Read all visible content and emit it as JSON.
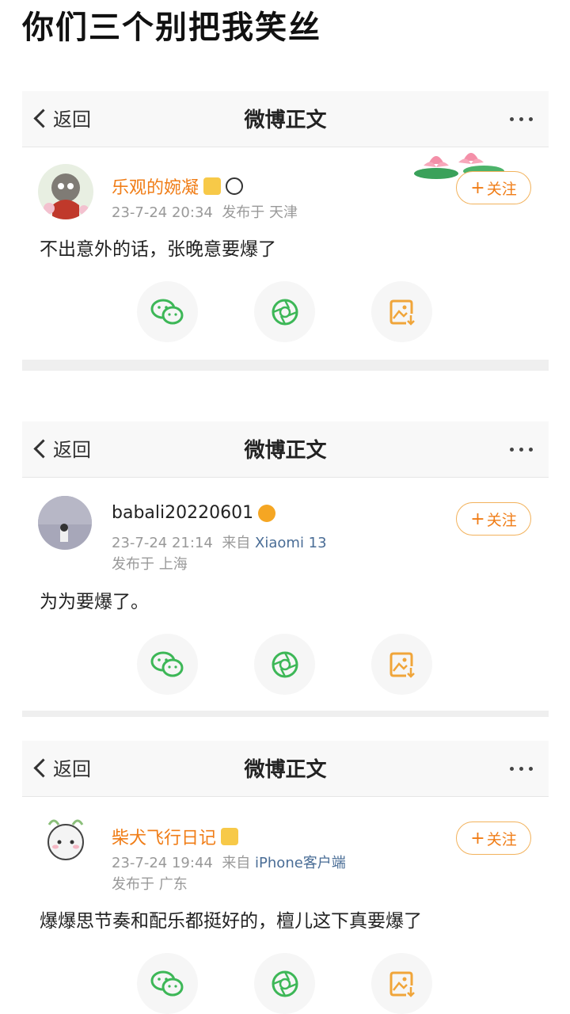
{
  "page": {
    "title": "你们三个别把我笑丝"
  },
  "nav": {
    "back_label": "返回",
    "title": "微博正文"
  },
  "follow_label": "关注",
  "posts": [
    {
      "username": "乐观的婉凝",
      "name_color": "#f07d17",
      "time": "23-7-24 20:34",
      "publish_prefix": "发布于",
      "location": "天津",
      "source_prefix": "",
      "source": "",
      "content": "不出意外的话，张晚意要爆了"
    },
    {
      "username": "babali20220601",
      "name_color": "#222222",
      "time": "23-7-24 21:14",
      "source_prefix": "来自",
      "source": "Xiaomi 13",
      "publish_prefix": "发布于",
      "location": "上海",
      "content": "为为要爆了。"
    },
    {
      "username": "柴犬飞行日记",
      "name_color": "#f07d17",
      "time": "23-7-24 19:44",
      "source_prefix": "来自",
      "source": "iPhone客户端",
      "publish_prefix": "发布于",
      "location": "广东",
      "content": "爆爆思节奏和配乐都挺好的，檀儿这下真要爆了"
    }
  ],
  "share_icons": [
    "wechat-icon",
    "moments-icon",
    "save-image-icon"
  ],
  "colors": {
    "accent_orange": "#f07d17",
    "follow_border": "#f2b25c",
    "wechat_green": "#3db757",
    "save_orange": "#f0a53a",
    "link_blue": "#4a6d96"
  }
}
